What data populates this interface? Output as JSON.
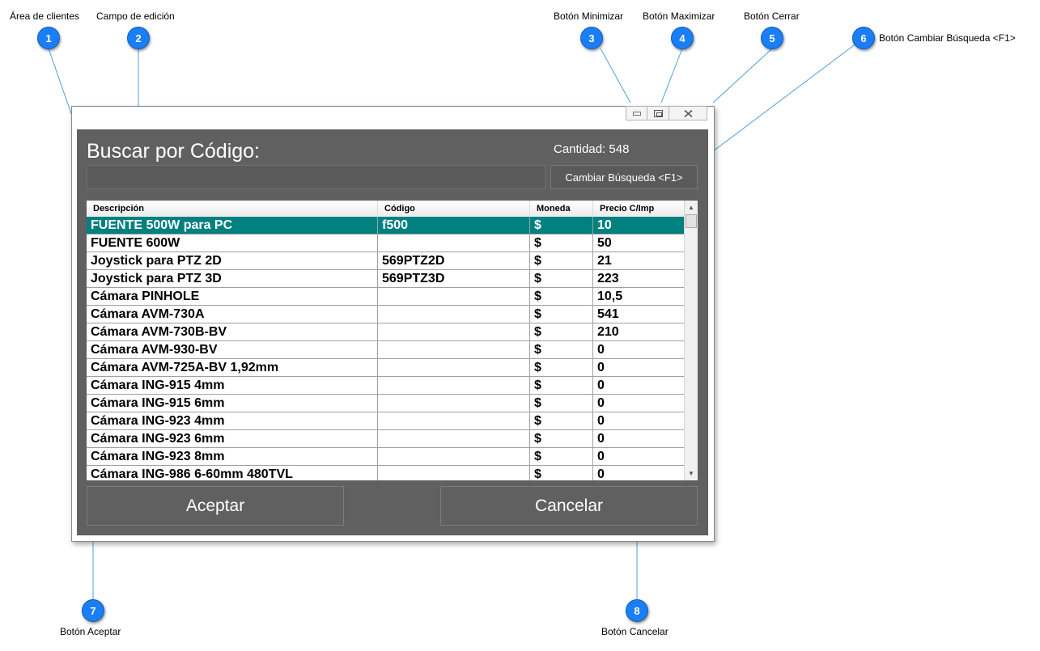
{
  "callouts": [
    {
      "num": "1",
      "label": "Área de clientes"
    },
    {
      "num": "2",
      "label": "Campo de edición"
    },
    {
      "num": "3",
      "label": "Botón Minimizar"
    },
    {
      "num": "4",
      "label": "Botón Maximizar"
    },
    {
      "num": "5",
      "label": "Botón Cerrar"
    },
    {
      "num": "6",
      "label": "Botón Cambiar Búsqueda <F1>"
    },
    {
      "num": "7",
      "label": "Botón Aceptar"
    },
    {
      "num": "8",
      "label": "Botón Cancelar"
    }
  ],
  "dialog": {
    "title": "Buscar por Código:",
    "count": "Cantidad: 548",
    "search_value": "",
    "change_search_label": "Cambiar Búsqueda <F1>",
    "accept_label": "Aceptar",
    "cancel_label": "Cancelar",
    "window_controls": {
      "minimize_icon": "minimize-icon",
      "maximize_icon": "restore-icon",
      "close_icon": "close-icon"
    }
  },
  "table": {
    "columns": [
      "Descripción",
      "Código",
      "Moneda",
      "Precio C/Imp"
    ],
    "selected_row": 0,
    "selected_color": "#018080",
    "rows": [
      [
        "FUENTE 500W para PC",
        "f500",
        "$",
        "10"
      ],
      [
        "FUENTE 600W",
        "",
        "$",
        "50"
      ],
      [
        "Joystick para PTZ 2D",
        "569PTZ2D",
        "$",
        "21"
      ],
      [
        "Joystick para PTZ 3D",
        "569PTZ3D",
        "$",
        "223"
      ],
      [
        "Cámara PINHOLE",
        "",
        "$",
        "10,5"
      ],
      [
        "Cámara AVM-730A",
        "",
        "$",
        "541"
      ],
      [
        "Cámara AVM-730B-BV",
        "",
        "$",
        "210"
      ],
      [
        "Cámara AVM-930-BV",
        "",
        "$",
        "0"
      ],
      [
        "Cámara AVM-725A-BV  1,92mm",
        "",
        "$",
        "0"
      ],
      [
        "Cámara ING-915 4mm",
        "",
        "$",
        "0"
      ],
      [
        "Cámara ING-915 6mm",
        "",
        "$",
        "0"
      ],
      [
        "Cámara ING-923 4mm",
        "",
        "$",
        "0"
      ],
      [
        "Cámara ING-923 6mm",
        "",
        "$",
        "0"
      ],
      [
        "Cámara ING-923 8mm",
        "",
        "$",
        "0"
      ],
      [
        "Cámara ING-986  6-60mm 480TVL",
        "",
        "$",
        "0"
      ]
    ]
  },
  "colors": {
    "callout_badge": "#1a7ef5",
    "dialog_background": "#606060"
  }
}
